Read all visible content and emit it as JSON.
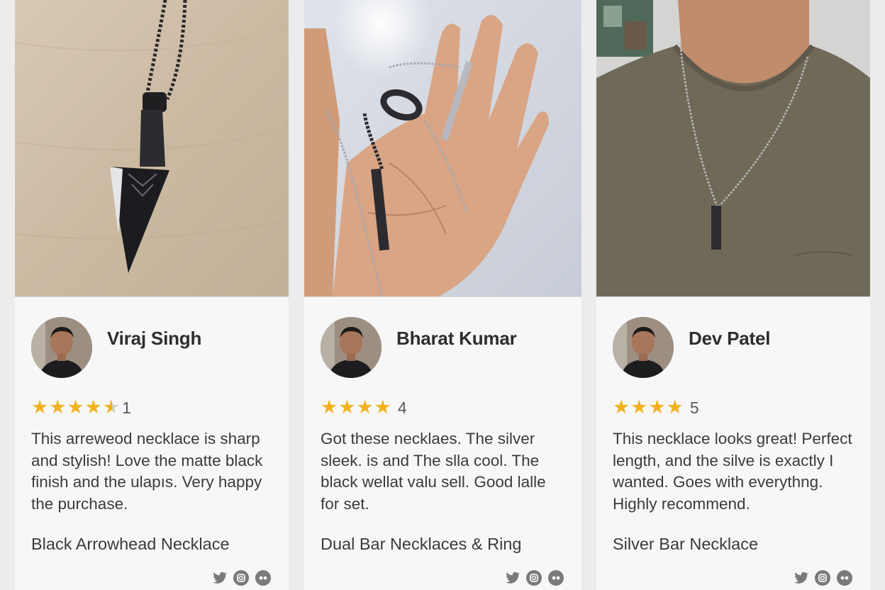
{
  "reviews": [
    {
      "reviewer": "Viraj Singh",
      "rating": 4.5,
      "rating_label": "1",
      "text": "This arrewеod necklace is sharp and stylish! Love the matte black finish and the ulapıs. Very happy the purchase.",
      "product": "Black Arrowhead Necklace"
    },
    {
      "reviewer": "Bharat Kumar",
      "rating": 4,
      "rating_label": "4",
      "text": "Got these necklaes. The silver sleek. is and The slla cool. The black wellat valu sell. Good lalle for set.",
      "product": "Dual Bar Necklaces & Ring"
    },
    {
      "reviewer": "Dev Patel",
      "rating": 4,
      "rating_label": "5",
      "text": "This necklace looks great! Perfect length, and the silve is exactly I wanted. Goes with everythng. Highly recommend.",
      "product": "Silver Bar Necklace"
    }
  ],
  "share_icons": [
    "twitter-icon",
    "instagram-icon",
    "flickr-icon"
  ],
  "colors": {
    "star": "#f2b21d",
    "card_bg": "#f7f7f7",
    "page_bg": "#ececec"
  }
}
